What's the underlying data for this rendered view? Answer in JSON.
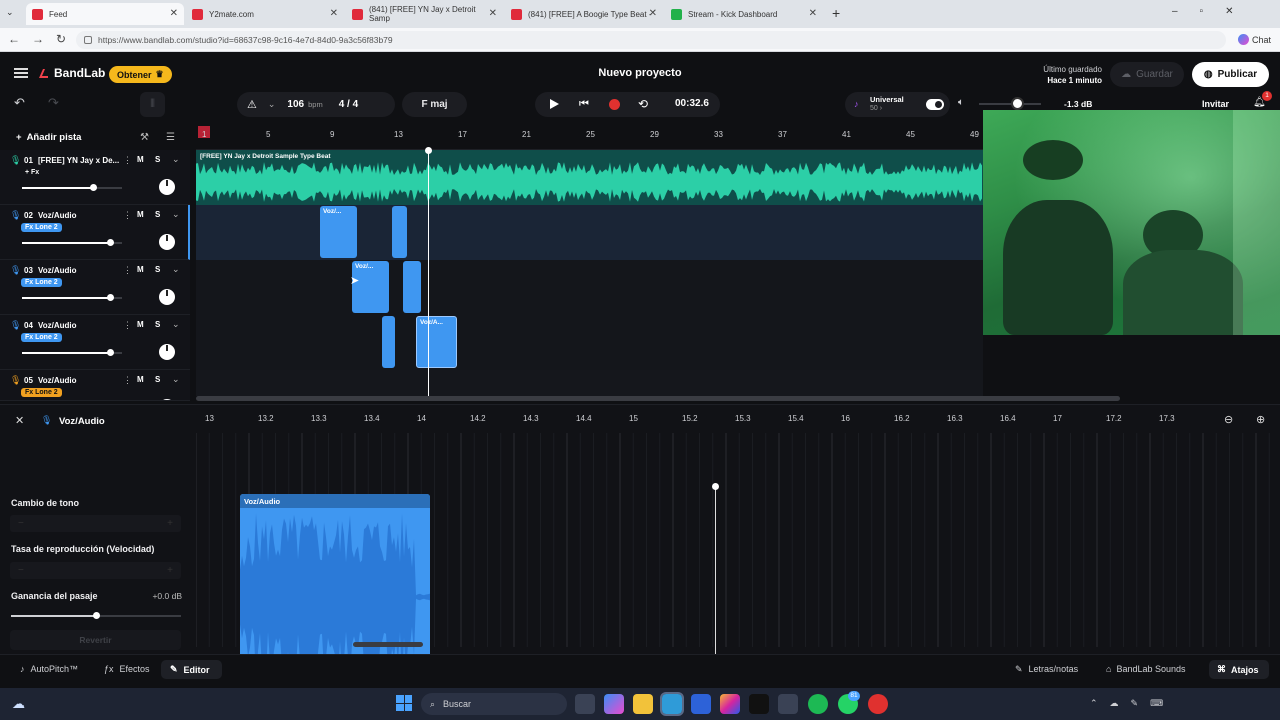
{
  "browser": {
    "tabs": [
      {
        "title": "Feed",
        "color": "#e02a3b"
      },
      {
        "title": "Y2mate.com",
        "color": "#e02a3b"
      },
      {
        "title": "(841) [FREE] YN Jay x Detroit Samp",
        "color": "#e02a3b"
      },
      {
        "title": "(841) [FREE] A Boogie Type Beat -",
        "color": "#e02a3b"
      },
      {
        "title": "Stream - Kick Dashboard",
        "color": "#21b14a"
      }
    ],
    "url": "https://www.bandlab.com/studio?id=68637c98-9c16-4e7d-84d0-9a3c56f83b79",
    "chat_label": "Chat"
  },
  "header": {
    "app_name": "BandLab",
    "obtener_label": "Obtener",
    "project_title": "Nuevo proyecto",
    "last_saved_label": "Último guardado",
    "last_saved_time": "Hace 1 minuto",
    "save_label": "Guardar",
    "publish_label": "Publicar"
  },
  "transport": {
    "bpm": "106",
    "bpm_unit": "bpm",
    "time_sig": "4 / 4",
    "key": "F maj",
    "time": "00:32.6",
    "preset_name": "Universal",
    "preset_value": "50",
    "volume_db": "-1.3 dB",
    "invite_label": "Invitar",
    "notif_count": "1"
  },
  "ruler": [
    "1",
    "5",
    "9",
    "13",
    "17",
    "21",
    "25",
    "29",
    "33",
    "37",
    "41",
    "45",
    "49"
  ],
  "add_track_label": "Añadir pista",
  "tracks": [
    {
      "num": "01",
      "name": "[FREE] YN Jay x De...",
      "badge": "+ Fx",
      "badge_color": "#121318",
      "badge_text": "#ffffff",
      "icon_color": "#2ccfa7"
    },
    {
      "num": "02",
      "name": "Voz/Audio",
      "badge": "Fx Lone 2",
      "badge_color": "#3f97f1",
      "badge_text": "#ffffff",
      "icon_color": "#3f97f1"
    },
    {
      "num": "03",
      "name": "Voz/Audio",
      "badge": "Fx Lone 2",
      "badge_color": "#3f97f1",
      "badge_text": "#ffffff",
      "icon_color": "#3f97f1"
    },
    {
      "num": "04",
      "name": "Voz/Audio",
      "badge": "Fx Lone 2",
      "badge_color": "#3f97f1",
      "badge_text": "#ffffff",
      "icon_color": "#3f97f1"
    },
    {
      "num": "05",
      "name": "Voz/Audio",
      "badge": "Fx Lone 2",
      "badge_color": "#f0a020",
      "badge_text": "#111111",
      "icon_color": "#f0a020"
    }
  ],
  "beat_clip_label": "[FREE] YN Jay x Detroit Sample Type Beat",
  "clip_labels": {
    "t2": "Voz/...",
    "t3": "Voz/...",
    "t4": "Voz/A..."
  },
  "editor": {
    "title": "Voz/Audio",
    "pitch_label": "Cambio de tono",
    "rate_label": "Tasa de reproducción (Velocidad)",
    "gain_label": "Ganancia del pasaje",
    "gain_value": "+0.0 dB",
    "revert_label": "Revertir",
    "clip_label": "Voz/Audio",
    "ruler": [
      "13",
      "13.2",
      "13.3",
      "13.4",
      "14",
      "14.2",
      "14.3",
      "14.4",
      "15",
      "15.2",
      "15.3",
      "15.4",
      "16",
      "16.2",
      "16.3",
      "16.4",
      "17",
      "17.2",
      "17.3"
    ]
  },
  "bottom": {
    "autopitch": "AutoPitch™",
    "effects": "Efectos",
    "editor": "Editor",
    "lyrics": "Letras/notas",
    "sounds": "BandLab Sounds",
    "shortcuts": "Atajos"
  },
  "taskbar": {
    "search_placeholder": "Buscar",
    "badge_count": "81"
  },
  "colors": {
    "accent_green": "#2ccfa7",
    "clip_blue": "#3f97f1",
    "record_red": "#e0312f",
    "obtener_yellow": "#f5b81c"
  }
}
